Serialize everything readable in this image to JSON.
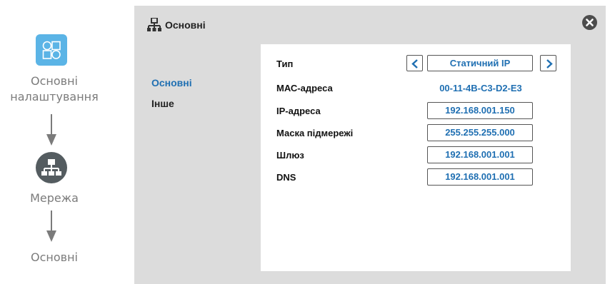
{
  "breadcrumb": {
    "items": [
      {
        "label": "Основні налаштування",
        "icon": "apps-grid-icon"
      },
      {
        "label": "Мережа",
        "icon": "network-icon"
      },
      {
        "label": "Основні"
      }
    ]
  },
  "panel": {
    "title": "Основні",
    "icon": "network-icon",
    "close_icon": "close-icon",
    "side_nav": [
      {
        "label": "Основні",
        "active": true
      },
      {
        "label": "Інше",
        "active": false
      }
    ],
    "fields": {
      "type": {
        "label": "Тип",
        "value": "Статичний IP"
      },
      "mac": {
        "label": "МАС-адреса",
        "value": "00-11-4B-C3-D2-E3"
      },
      "ip": {
        "label": "IP-адреса",
        "value": "192.168.001.150"
      },
      "mask": {
        "label": "Маска підмережі",
        "value": "255.255.255.000"
      },
      "gateway": {
        "label": "Шлюз",
        "value": "192.168.001.001"
      },
      "dns": {
        "label": "DNS",
        "value": "192.168.001.001"
      }
    }
  },
  "colors": {
    "accent": "#1f6fb2",
    "panel_bg": "#dcdcdc",
    "app_icon_bg": "#5bb4e6",
    "network_icon_bg": "#545c60",
    "breadcrumb_text": "#7b7b7b"
  }
}
